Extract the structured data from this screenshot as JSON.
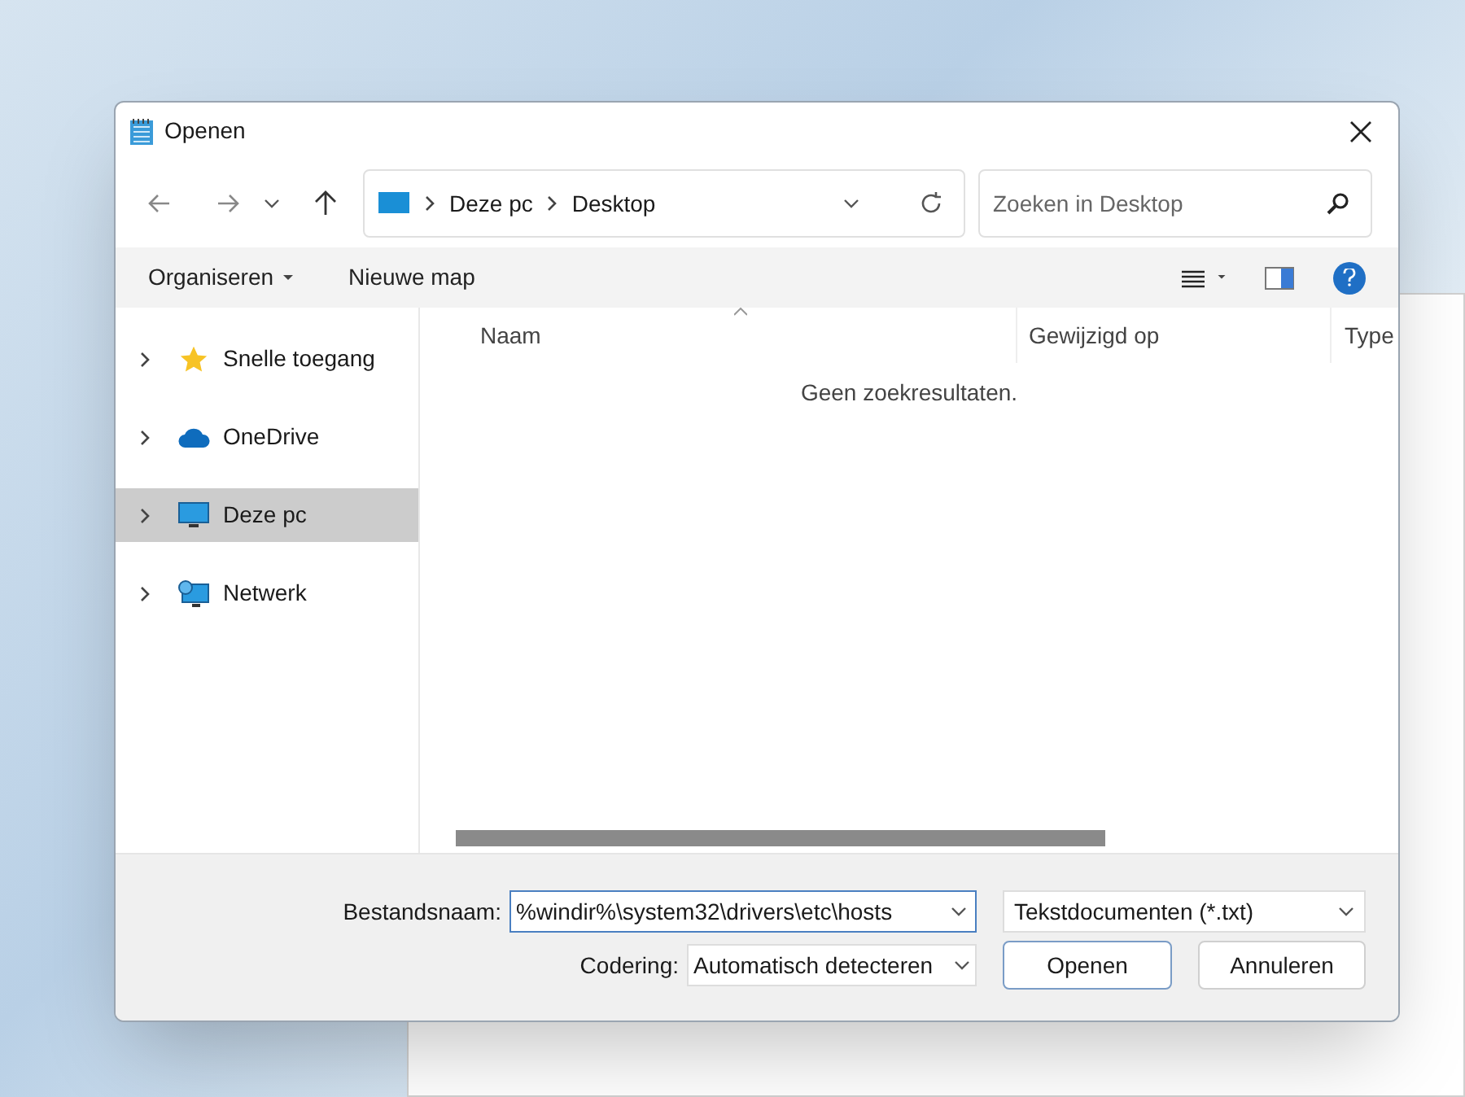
{
  "window": {
    "title": "Openen"
  },
  "navigation": {
    "breadcrumb": [
      "Deze pc",
      "Desktop"
    ],
    "search": {
      "placeholder": "Zoeken in Desktop"
    }
  },
  "toolbar": {
    "organize": "Organiseren",
    "new_folder": "Nieuwe map"
  },
  "sidebar": {
    "items": [
      {
        "label": "Snelle toegang",
        "kind": "quick_access",
        "selected": false
      },
      {
        "label": "OneDrive",
        "kind": "cloud",
        "selected": false
      },
      {
        "label": "Deze pc",
        "kind": "computer",
        "selected": true
      },
      {
        "label": "Netwerk",
        "kind": "network",
        "selected": false
      }
    ]
  },
  "file_list": {
    "columns": [
      "Naam",
      "Gewijzigd op",
      "Type"
    ],
    "empty_message": "Geen zoekresultaten."
  },
  "footer": {
    "filename_label": "Bestandsnaam:",
    "filename_value": "%windir%\\system32\\drivers\\etc\\hosts",
    "file_type": "Tekstdocumenten (*.txt)",
    "encoding_label": "Codering:",
    "encoding_value": "Automatisch detecteren",
    "buttons": [
      "Openen",
      "Annuleren"
    ]
  }
}
